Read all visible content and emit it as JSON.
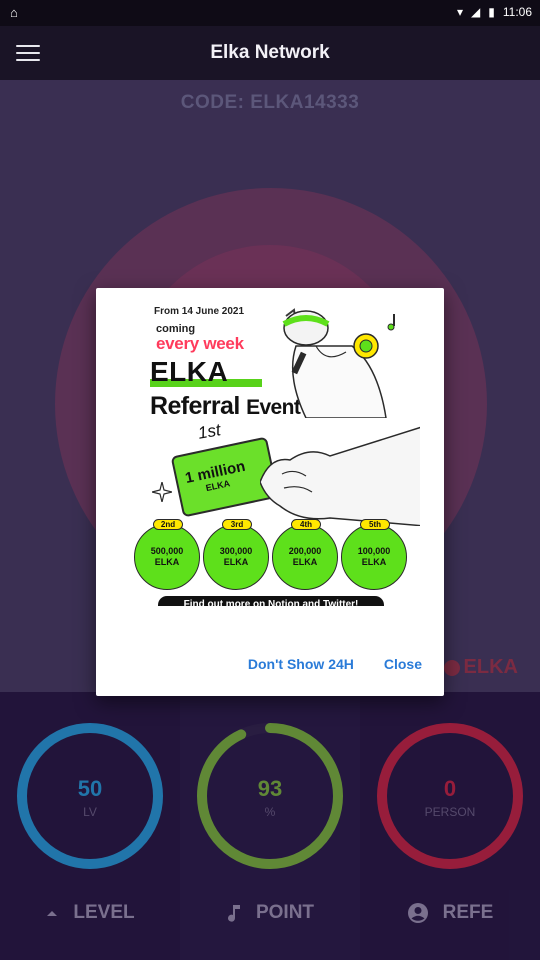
{
  "status_bar": {
    "time": "11:06"
  },
  "app_bar": {
    "title": "Elka Network"
  },
  "main": {
    "code": "CODE: ELKA14333",
    "balance_label": "ELKA"
  },
  "stats": [
    {
      "value": "50",
      "unit": "LV",
      "button": "LEVEL",
      "color": "#1ea9e0",
      "progress": 1.0
    },
    {
      "value": "93",
      "unit": "%",
      "button": "POINT",
      "color": "#7fc72f",
      "progress": 0.93
    },
    {
      "value": "0",
      "unit": "PERSON",
      "button": "REFE",
      "color": "#d32236",
      "progress": 1.0
    }
  ],
  "dialog": {
    "poster": {
      "date": "From 14 June 2021",
      "coming": "coming",
      "every_week": "every week",
      "brand": "ELKA",
      "title_a": "Referral",
      "title_b": "Event",
      "first": "1st",
      "card_amount": "1 million",
      "card_unit": "ELKA",
      "prizes": [
        {
          "rank": "2nd",
          "amount": "500,000",
          "unit": "ELKA"
        },
        {
          "rank": "3rd",
          "amount": "300,000",
          "unit": "ELKA"
        },
        {
          "rank": "4th",
          "amount": "200,000",
          "unit": "ELKA"
        },
        {
          "rank": "5th",
          "amount": "100,000",
          "unit": "ELKA"
        }
      ],
      "footer": "Find out more on Notion and Twitter!"
    },
    "dont_show_label": "Don't Show 24H",
    "close_label": "Close"
  }
}
